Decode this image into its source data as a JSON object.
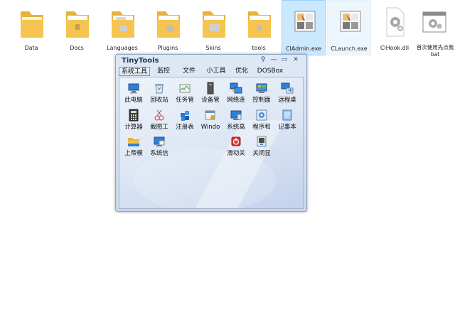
{
  "desktop": {
    "items": [
      {
        "label": "Data",
        "type": "folder",
        "icon": "folder-icon"
      },
      {
        "label": "Docs",
        "type": "folder",
        "icon": "folder-icon"
      },
      {
        "label": "Languages",
        "type": "folder",
        "icon": "folder-icon"
      },
      {
        "label": "Plugins",
        "type": "folder",
        "icon": "folder-icon"
      },
      {
        "label": "Skins",
        "type": "folder",
        "icon": "folder-icon"
      },
      {
        "label": "tools",
        "type": "folder",
        "icon": "folder-icon"
      },
      {
        "label": "ClAdmin.exe",
        "type": "exe",
        "icon": "window-app-icon",
        "selected": true
      },
      {
        "label": "CLaunch.exe",
        "type": "exe",
        "icon": "window-app-icon"
      },
      {
        "label": "ClHook.dll",
        "type": "dll",
        "icon": "gear-file-icon"
      },
      {
        "label": "首次使用先点我",
        "label2": "bat",
        "type": "bat",
        "icon": "gear-window-icon"
      }
    ]
  },
  "tinytools": {
    "title": "TinyTools",
    "controls": {
      "pin": "⚲",
      "minimize": "—",
      "restore": "▭",
      "close": "✕"
    },
    "tabs": [
      "系统工具",
      "监控",
      "文件",
      "小工具",
      "优化",
      "DOSBox"
    ],
    "active_tab": 0,
    "tools": [
      {
        "label": "此电脑",
        "icon": "computer-icon"
      },
      {
        "label": "回收站",
        "icon": "recycle-bin-icon"
      },
      {
        "label": "任务管",
        "icon": "task-manager-icon"
      },
      {
        "label": "设备管",
        "icon": "device-manager-icon"
      },
      {
        "label": "网络连",
        "icon": "network-icon"
      },
      {
        "label": "控制面",
        "icon": "control-panel-icon"
      },
      {
        "label": "远程桌",
        "icon": "remote-desktop-icon"
      },
      {
        "label": "计算器",
        "icon": "calculator-icon"
      },
      {
        "label": "截图工",
        "icon": "snipping-tool-icon"
      },
      {
        "label": "注册表",
        "icon": "registry-icon"
      },
      {
        "label": "Windo",
        "icon": "windows-tool-icon"
      },
      {
        "label": "系统高",
        "icon": "system-advanced-icon"
      },
      {
        "label": "程序和",
        "icon": "programs-icon"
      },
      {
        "label": "记事本",
        "icon": "notepad-icon"
      },
      {
        "label": "上帝模",
        "icon": "god-mode-folder-icon"
      },
      {
        "label": "系统信",
        "icon": "system-info-icon"
      },
      {
        "label": "滑动关",
        "icon": "slide-shutdown-icon"
      },
      {
        "label": "关闭显",
        "icon": "monitor-off-icon"
      }
    ]
  },
  "colors": {
    "selection": "#cce8ff",
    "folder": "#f5c451",
    "window_border": "#8fa5c6",
    "title_text": "#1f3558"
  }
}
